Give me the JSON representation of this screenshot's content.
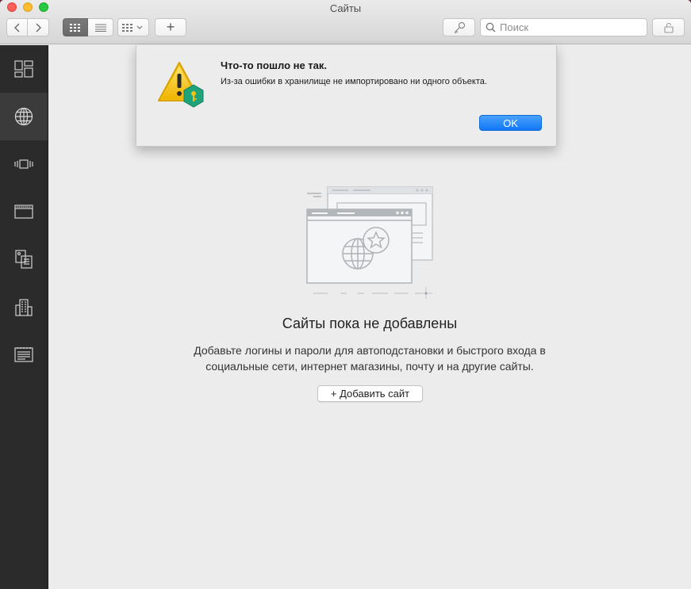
{
  "window": {
    "title": "Сайты"
  },
  "toolbar": {
    "add_label": "+",
    "search_placeholder": "Поиск"
  },
  "sidebar": {
    "items": [
      {
        "icon": "dashboard-icon"
      },
      {
        "icon": "globe-icon",
        "active": true
      },
      {
        "icon": "bank-card-icon"
      },
      {
        "icon": "card-icon"
      },
      {
        "icon": "documents-icon"
      },
      {
        "icon": "building-icon"
      },
      {
        "icon": "notes-icon"
      }
    ]
  },
  "main": {
    "empty_title": "Сайты пока не добавлены",
    "empty_desc": "Добавьте логины и пароли для автоподстановки и быстрого входа в социальные сети, интернет магазины, почту и на другие сайты.",
    "add_button": "+ Добавить сайт"
  },
  "alert": {
    "title": "Что-то пошло не так.",
    "message": "Из-за ошибки в хранилище не импортировано ни одного объекта.",
    "ok_label": "OK"
  },
  "colors": {
    "accent": "#1177f5",
    "sidebar": "#2b2b2b",
    "warning": "#f5c211",
    "badge": "#1fa37a"
  }
}
